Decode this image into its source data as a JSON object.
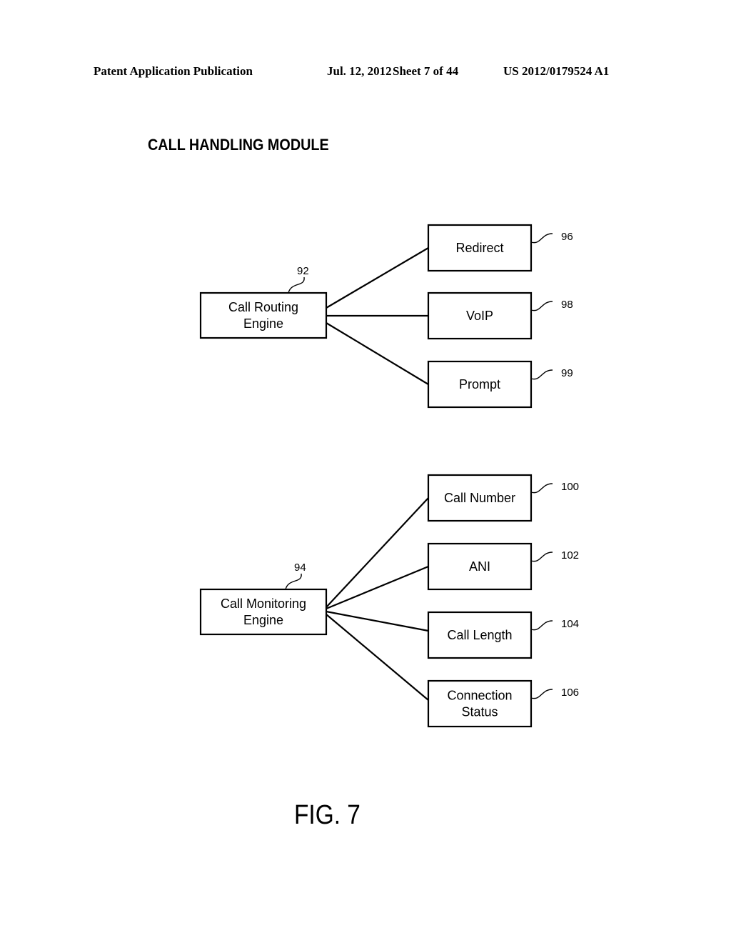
{
  "header": {
    "publication": "Patent Application Publication",
    "date": "Jul. 12, 2012",
    "sheet": "Sheet 7 of 44",
    "number": "US 2012/0179524 A1"
  },
  "title": "CALL HANDLING MODULE",
  "figure_label": "FIG. 7",
  "diagram": {
    "groups": [
      {
        "parent": {
          "id": "92",
          "lines": [
            "Call Routing",
            "Engine"
          ]
        },
        "children": [
          {
            "id": "96",
            "lines": [
              "Redirect"
            ]
          },
          {
            "id": "98",
            "lines": [
              "VoIP"
            ]
          },
          {
            "id": "99",
            "lines": [
              "Prompt"
            ]
          }
        ]
      },
      {
        "parent": {
          "id": "94",
          "lines": [
            "Call Monitoring",
            "Engine"
          ]
        },
        "children": [
          {
            "id": "100",
            "lines": [
              "Call Number"
            ]
          },
          {
            "id": "102",
            "lines": [
              "ANI"
            ]
          },
          {
            "id": "104",
            "lines": [
              "Call Length"
            ]
          },
          {
            "id": "106",
            "lines": [
              "Connection",
              "Status"
            ]
          }
        ]
      }
    ]
  }
}
